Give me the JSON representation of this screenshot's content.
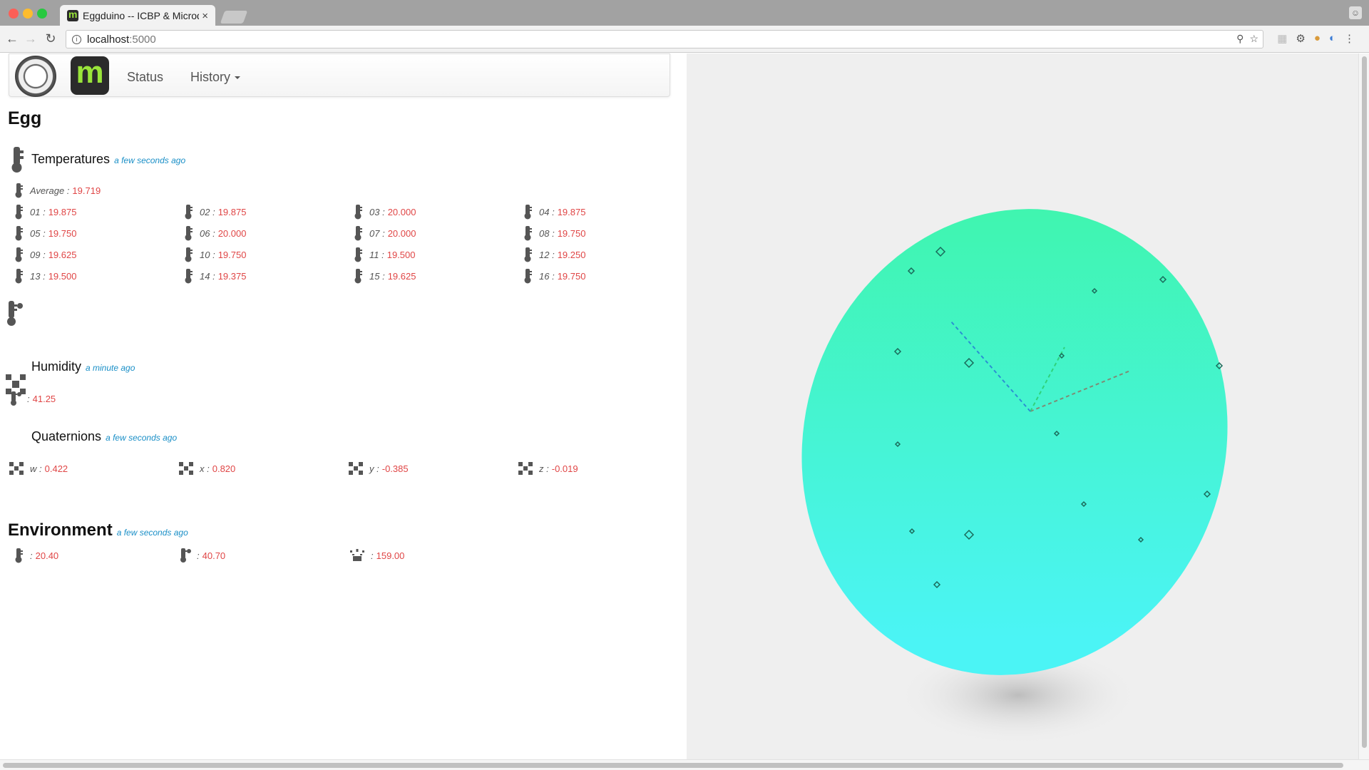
{
  "browser": {
    "tab_title": "Eggduino -- ICBP & Microduino",
    "tab_close": "×",
    "url_host": "localhost",
    "url_port": ":5000"
  },
  "navbar": {
    "status_label": "Status",
    "history_label": "History"
  },
  "egg": {
    "title": "Egg",
    "temperatures": {
      "title": "Temperatures",
      "updated": "a few seconds ago",
      "average_label": "Average :",
      "average_value": "19.719",
      "sensors": [
        {
          "label": "01 :",
          "value": "19.875"
        },
        {
          "label": "02 :",
          "value": "19.875"
        },
        {
          "label": "03 :",
          "value": "20.000"
        },
        {
          "label": "04 :",
          "value": "19.875"
        },
        {
          "label": "05 :",
          "value": "19.750"
        },
        {
          "label": "06 :",
          "value": "20.000"
        },
        {
          "label": "07 :",
          "value": "20.000"
        },
        {
          "label": "08 :",
          "value": "19.750"
        },
        {
          "label": "09 :",
          "value": "19.625"
        },
        {
          "label": "10 :",
          "value": "19.750"
        },
        {
          "label": "11 :",
          "value": "19.500"
        },
        {
          "label": "12 :",
          "value": "19.250"
        },
        {
          "label": "13 :",
          "value": "19.500"
        },
        {
          "label": "14 :",
          "value": "19.375"
        },
        {
          "label": "15 :",
          "value": "19.625"
        },
        {
          "label": "16 :",
          "value": "19.750"
        }
      ]
    },
    "humidity": {
      "title": "Humidity",
      "updated": "a minute ago",
      "label": ":",
      "value": "41.25"
    },
    "quaternions": {
      "title": "Quaternions",
      "updated": "a few seconds ago",
      "items": [
        {
          "label": "w :",
          "value": "0.422"
        },
        {
          "label": "x :",
          "value": "0.820"
        },
        {
          "label": "y :",
          "value": "-0.385"
        },
        {
          "label": "z :",
          "value": "-0.019"
        }
      ]
    }
  },
  "environment": {
    "title": "Environment",
    "updated": "a few seconds ago",
    "items": [
      {
        "icon": "thermometer-icon",
        "label": ":",
        "value": "20.40"
      },
      {
        "icon": "humidity-icon",
        "label": ":",
        "value": "40.70"
      },
      {
        "icon": "light-icon",
        "label": ":",
        "value": "159.00"
      }
    ]
  },
  "colors": {
    "value_red": "#e04646",
    "timestamp_blue": "#1a8fc7",
    "egg_top": "#3ef5a6",
    "egg_bottom": "#4bf4f5"
  }
}
